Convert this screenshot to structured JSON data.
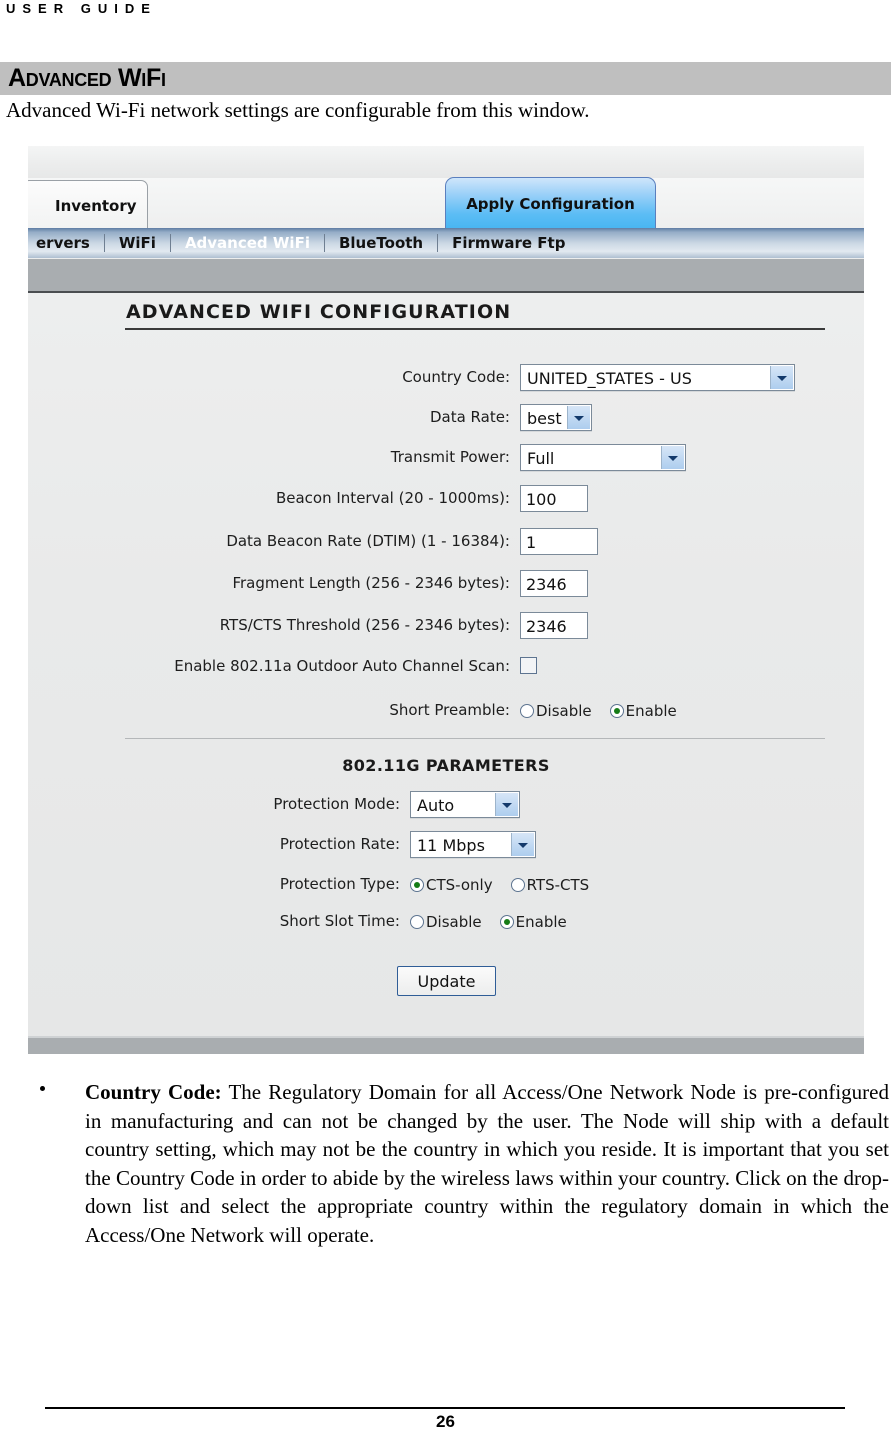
{
  "document": {
    "running_head": "USER GUIDE",
    "section_title": "Advanced WiFi",
    "intro_text": "Advanced Wi-Fi network settings are configurable from this window.",
    "page_number": "26"
  },
  "screenshot": {
    "tabs": {
      "inventory": "Inventory",
      "apply_configuration": "Apply Configuration"
    },
    "navbar": [
      {
        "label": "ervers",
        "active": false
      },
      {
        "label": "WiFi",
        "active": false
      },
      {
        "label": "Advanced WiFi",
        "active": true
      },
      {
        "label": "BlueTooth",
        "active": false
      },
      {
        "label": "Firmware Ftp",
        "active": false
      }
    ],
    "panel_title": "ADVANCED WIFI CONFIGURATION",
    "fields": [
      {
        "label": "Country Code:",
        "type": "select",
        "value": "UNITED_STATES - US"
      },
      {
        "label": "Data Rate:",
        "type": "select",
        "value": "best"
      },
      {
        "label": "Transmit Power:",
        "type": "select",
        "value": "Full"
      },
      {
        "label": "Beacon Interval (20 - 1000ms):",
        "type": "text",
        "value": "100"
      },
      {
        "label": "Data Beacon Rate (DTIM) (1 - 16384):",
        "type": "text",
        "value": "1"
      },
      {
        "label": "Fragment Length (256 - 2346 bytes):",
        "type": "text",
        "value": "2346"
      },
      {
        "label": "RTS/CTS Threshold (256 - 2346 bytes):",
        "type": "text",
        "value": "2346"
      },
      {
        "label": "Enable 802.11a Outdoor Auto Channel Scan:",
        "type": "checkbox",
        "checked": false
      },
      {
        "label": "Short Preamble:",
        "type": "radio",
        "options": [
          "Disable",
          "Enable"
        ],
        "selected": "Enable"
      }
    ],
    "subsection_title": "802.11G PARAMETERS",
    "g_fields": [
      {
        "label": "Protection Mode:",
        "type": "select",
        "value": "Auto"
      },
      {
        "label": "Protection Rate:",
        "type": "select",
        "value": "11 Mbps"
      },
      {
        "label": "Protection Type:",
        "type": "radio",
        "options": [
          "CTS-only",
          "RTS-CTS"
        ],
        "selected": "CTS-only"
      },
      {
        "label": "Short Slot Time:",
        "type": "radio",
        "options": [
          "Disable",
          "Enable"
        ],
        "selected": "Enable"
      }
    ],
    "update_button": "Update"
  },
  "body": {
    "bullet_term": "Country Code:",
    "bullet_body": " The Regulatory Domain for all Access/One Network Node is pre-configured in manufacturing and can not be changed by the user. The Node will ship with a default country setting, which may not be the country in which you reside. It is important that you set the Country Code in order to abide by the wireless laws within your country. Click on the drop-down list and select the appropriate country within the regulatory domain in which the Access/One Network will operate."
  }
}
